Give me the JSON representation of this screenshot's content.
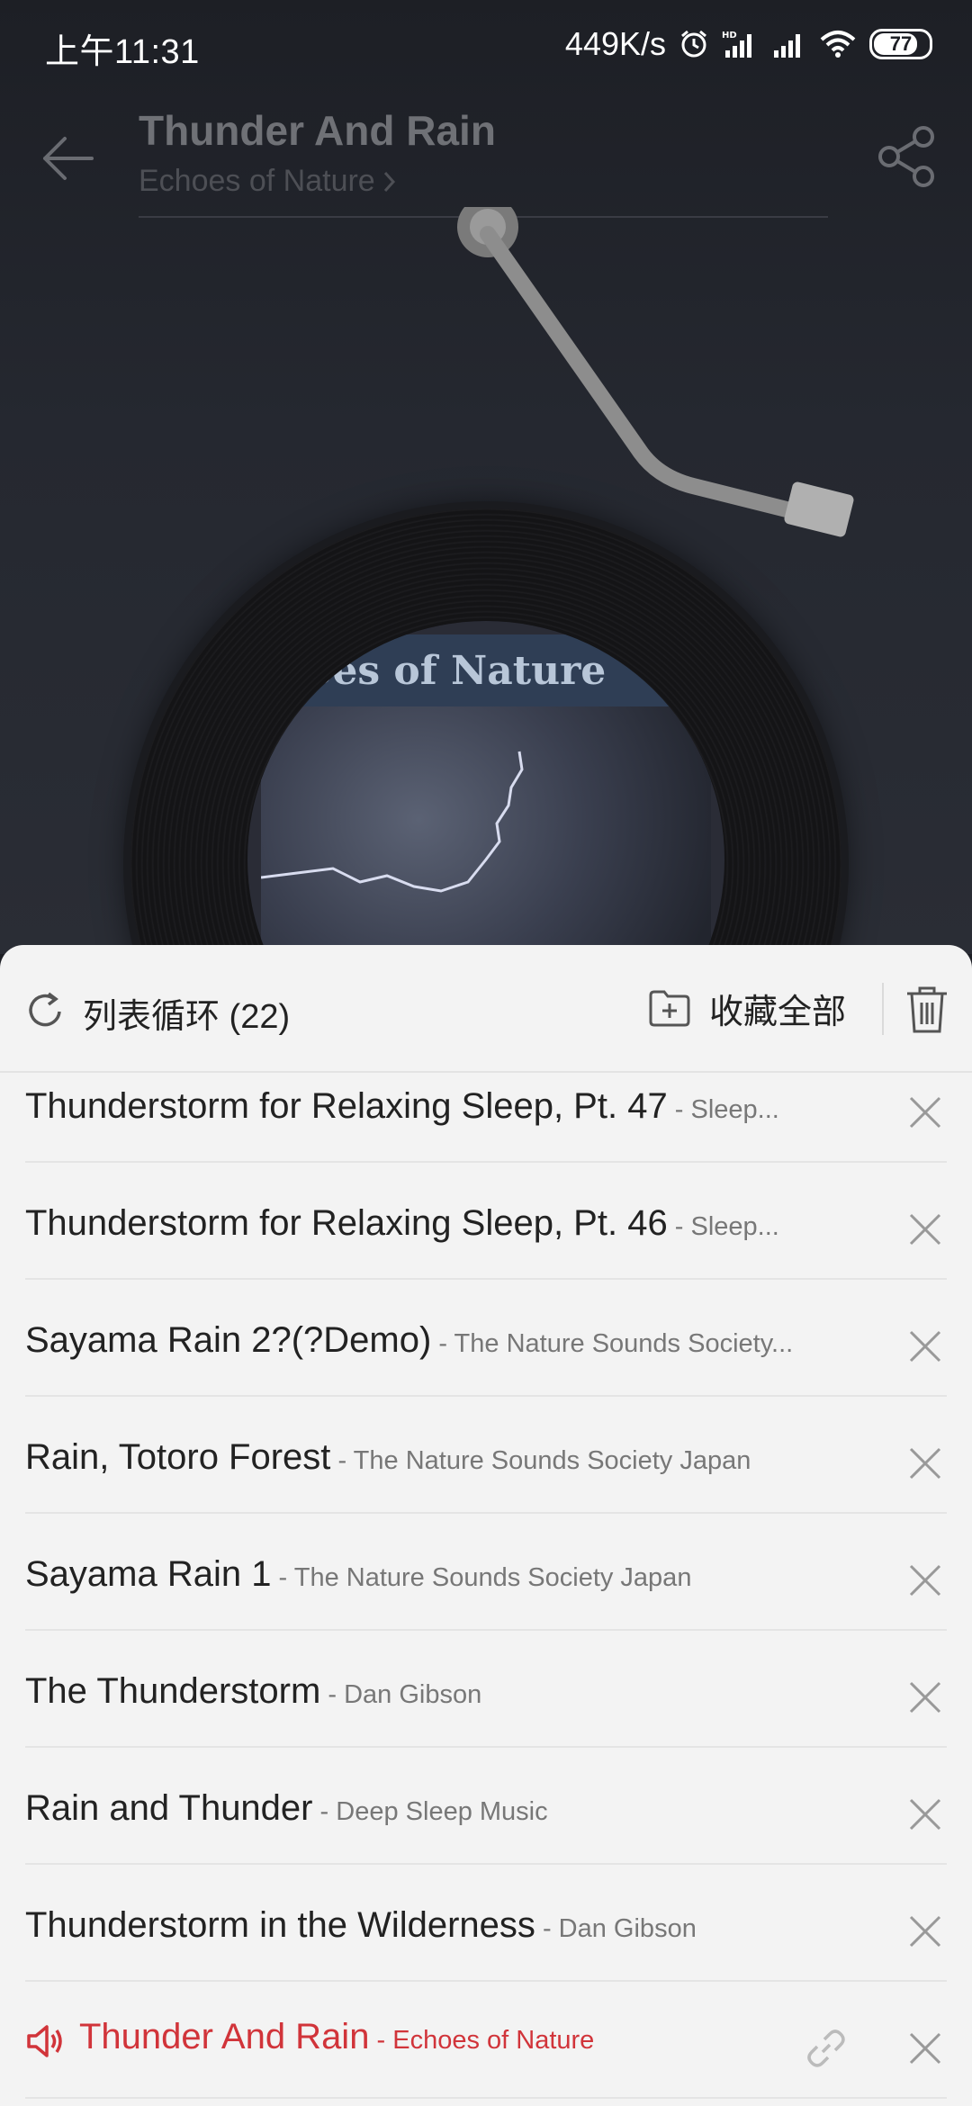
{
  "status": {
    "time": "上午11:31",
    "network_speed": "449K/s",
    "battery": "77",
    "icons": [
      "alarm-icon",
      "hd-signal-icon",
      "signal-icon",
      "wifi-icon",
      "battery-icon"
    ]
  },
  "now_playing": {
    "title": "Thunder And Rain",
    "artist": "Echoes of Nature",
    "album_banner": "oes of Nature"
  },
  "playlist": {
    "mode_label": "列表循环 (22)",
    "collect_label": "收藏全部",
    "tracks": [
      {
        "title": "Thunderstorm for Relaxing Sleep, Pt. 47",
        "artist": " - Sleep..."
      },
      {
        "title": "Thunderstorm for Relaxing Sleep, Pt. 46",
        "artist": " - Sleep..."
      },
      {
        "title": "Sayama Rain 2?(?Demo)",
        "artist": " - The Nature Sounds Society..."
      },
      {
        "title": "Rain, Totoro Forest",
        "artist": " - The Nature Sounds Society Japan"
      },
      {
        "title": "Sayama Rain 1",
        "artist": " - The Nature Sounds Society Japan"
      },
      {
        "title": "The Thunderstorm",
        "artist": " - Dan Gibson"
      },
      {
        "title": "Rain and Thunder",
        "artist": " - Deep Sleep Music"
      },
      {
        "title": "Thunderstorm in the Wilderness",
        "artist": " - Dan Gibson"
      },
      {
        "title": "Thunder And Rain",
        "artist": " - Echoes of Nature"
      }
    ]
  },
  "colors": {
    "accent": "#d1343a",
    "sheet_bg": "#f3f3f3",
    "player_bg": "#1e2026"
  }
}
